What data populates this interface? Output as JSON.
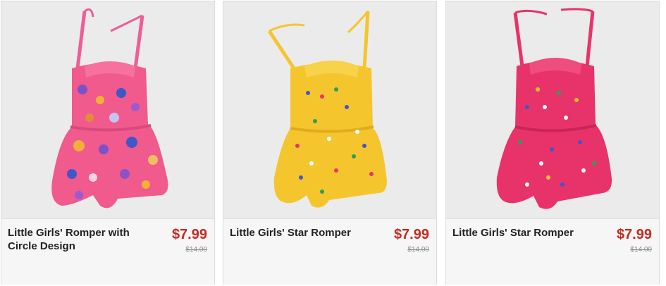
{
  "products": [
    {
      "title": "Little Girls' Romper with Circle Design",
      "price": "$7.99",
      "original_price": "$14.00",
      "image_desc": "pink romper with colorful peace-sign circles",
      "color": "#f05a8c"
    },
    {
      "title": "Little Girls' Star Romper",
      "price": "$7.99",
      "original_price": "$14.00",
      "image_desc": "yellow romper with multicolor stars",
      "color": "#f5c52e"
    },
    {
      "title": "Little Girls' Star Romper",
      "price": "$7.99",
      "original_price": "$14.00",
      "image_desc": "hot pink romper with multicolor stars",
      "color": "#e8336a"
    }
  ],
  "colors": {
    "price": "#c8281e",
    "title": "#222222",
    "strike": "#8c8c8c"
  }
}
